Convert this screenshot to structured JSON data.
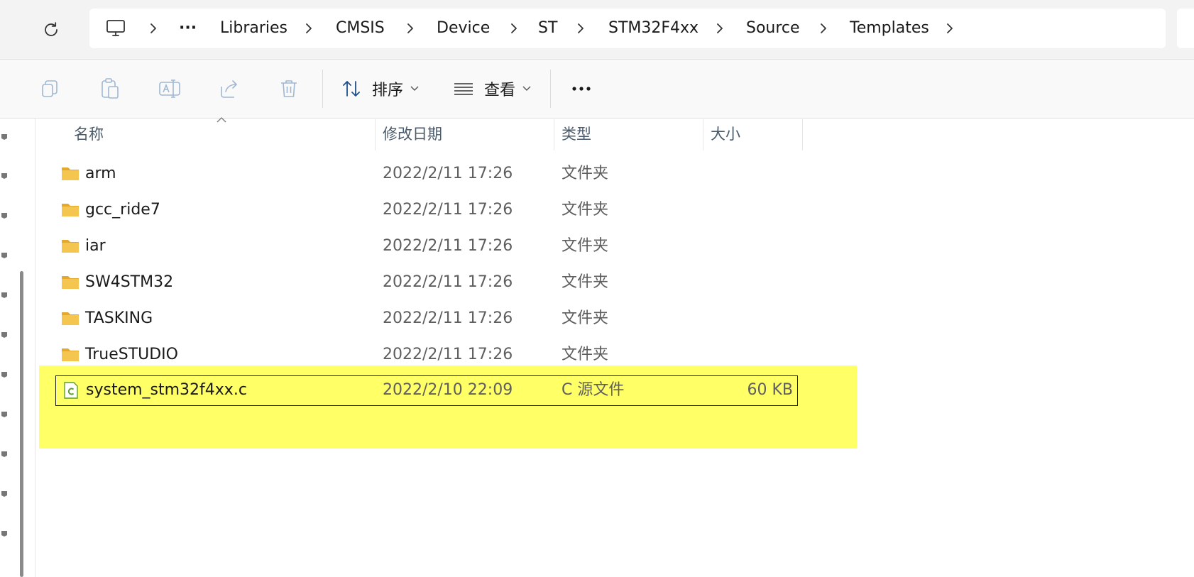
{
  "address": {
    "overflow_label": "···",
    "crumbs": [
      "Libraries",
      "CMSIS",
      "Device",
      "ST",
      "STM32F4xx",
      "Source",
      "Templates"
    ]
  },
  "toolbar": {
    "sort_label": "排序",
    "view_label": "查看",
    "more_label": "···"
  },
  "columns": {
    "name": "名称",
    "modified": "修改日期",
    "type": "类型",
    "size": "大小"
  },
  "files": [
    {
      "name": "arm",
      "modified": "2022/2/11 17:26",
      "type": "文件夹",
      "size": "",
      "icon": "folder-icon"
    },
    {
      "name": "gcc_ride7",
      "modified": "2022/2/11 17:26",
      "type": "文件夹",
      "size": "",
      "icon": "folder-icon"
    },
    {
      "name": "iar",
      "modified": "2022/2/11 17:26",
      "type": "文件夹",
      "size": "",
      "icon": "folder-icon"
    },
    {
      "name": "SW4STM32",
      "modified": "2022/2/11 17:26",
      "type": "文件夹",
      "size": "",
      "icon": "folder-icon"
    },
    {
      "name": "TASKING",
      "modified": "2022/2/11 17:26",
      "type": "文件夹",
      "size": "",
      "icon": "folder-icon"
    },
    {
      "name": "TrueSTUDIO",
      "modified": "2022/2/11 17:26",
      "type": "文件夹",
      "size": "",
      "icon": "folder-icon"
    },
    {
      "name": "system_stm32f4xx.c",
      "modified": "2022/2/10 22:09",
      "type": "C 源文件",
      "size": "60 KB",
      "icon": "c-file-icon"
    }
  ],
  "colors": {
    "highlight": "#ffff66",
    "folder": "#f4c64f",
    "folder_dark": "#e3a82c",
    "c_file": "#5f9e2c"
  }
}
